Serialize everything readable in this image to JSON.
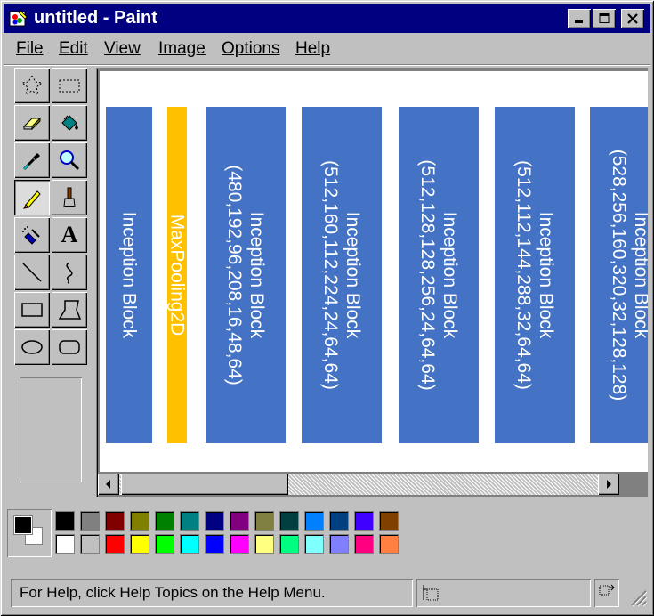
{
  "window": {
    "title": "untitled - Paint",
    "buttons": [
      "minimize",
      "maximize",
      "close"
    ]
  },
  "menu": {
    "items": [
      {
        "label": "File"
      },
      {
        "label": "Edit"
      },
      {
        "label": "View"
      },
      {
        "label": "Image"
      },
      {
        "label": "Options"
      },
      {
        "label": "Help"
      }
    ]
  },
  "tools": [
    {
      "icon": "free-form-select-icon"
    },
    {
      "icon": "rect-select-icon"
    },
    {
      "icon": "eraser-icon"
    },
    {
      "icon": "fill-bucket-icon"
    },
    {
      "icon": "color-picker-icon"
    },
    {
      "icon": "magnifier-icon"
    },
    {
      "icon": "pencil-icon",
      "selected": true
    },
    {
      "icon": "brush-icon"
    },
    {
      "icon": "airbrush-icon"
    },
    {
      "icon": "text-icon",
      "glyph": "A"
    },
    {
      "icon": "line-icon"
    },
    {
      "icon": "curve-icon"
    },
    {
      "icon": "rectangle-icon"
    },
    {
      "icon": "polygon-icon"
    },
    {
      "icon": "ellipse-icon"
    },
    {
      "icon": "rounded-rectangle-icon"
    }
  ],
  "canvas": {
    "blocks": [
      {
        "line1": "Inception Block",
        "line2": "",
        "color": "#4472c4"
      },
      {
        "line1": "MaxPooling2D",
        "line2": "",
        "color": "#ffc000"
      },
      {
        "line1": "Inception Block",
        "line2": "(480,192,96,208,16,48,64)",
        "color": "#4472c4"
      },
      {
        "line1": "Inception Block",
        "line2": "(512,160,112,224,24,64,64)",
        "color": "#4472c4"
      },
      {
        "line1": "Inception Block",
        "line2": "(512,128,128,256,24,64,64)",
        "color": "#4472c4"
      },
      {
        "line1": "Inception Block",
        "line2": "(512,112,144,288,32,64,64)",
        "color": "#4472c4"
      },
      {
        "line1": "Inception Block",
        "line2": "(528,256,160,320,32,128,128)",
        "color": "#4472c4"
      }
    ]
  },
  "palette": {
    "foreground": "#000000",
    "background": "#ffffff",
    "top_row": [
      "#000000",
      "#808080",
      "#800000",
      "#808000",
      "#008000",
      "#008080",
      "#000080",
      "#800080",
      "#808040",
      "#004040",
      "#0080ff",
      "#004080",
      "#4000ff",
      "#804000"
    ],
    "bottom_row": [
      "#ffffff",
      "#c0c0c0",
      "#ff0000",
      "#ffff00",
      "#00ff00",
      "#00ffff",
      "#0000ff",
      "#ff00ff",
      "#ffff80",
      "#00ff80",
      "#80ffff",
      "#8080ff",
      "#ff0080",
      "#ff8040"
    ]
  },
  "status": {
    "help_text": "For Help, click Help Topics on the Help Menu."
  }
}
